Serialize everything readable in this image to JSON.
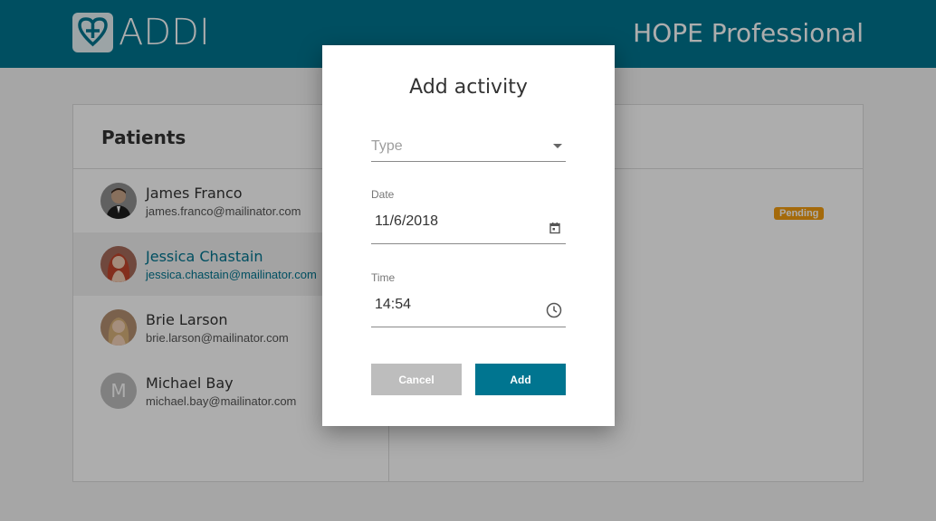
{
  "header": {
    "logo_text": "ADDI",
    "app_name": "HOPE Professional",
    "color": "#007590"
  },
  "patients": {
    "title": "Patients",
    "items": [
      {
        "name": "James Franco",
        "email": "james.franco@mailinator.com",
        "avatar": "photo"
      },
      {
        "name": "Jessica Chastain",
        "email": "jessica.chastain@mailinator.com",
        "avatar": "photo",
        "selected": true
      },
      {
        "name": "Brie Larson",
        "email": "brie.larson@mailinator.com",
        "avatar": "photo"
      },
      {
        "name": "Michael Bay",
        "email": "michael.bay@mailinator.com",
        "avatar": "M"
      }
    ]
  },
  "detail": {
    "status_badge": "Pending"
  },
  "dialog": {
    "title": "Add activity",
    "type_placeholder": "Type",
    "date_label": "Date",
    "date_value": "11/6/2018",
    "time_label": "Time",
    "time_value": "14:54",
    "cancel_label": "Cancel",
    "add_label": "Add"
  }
}
